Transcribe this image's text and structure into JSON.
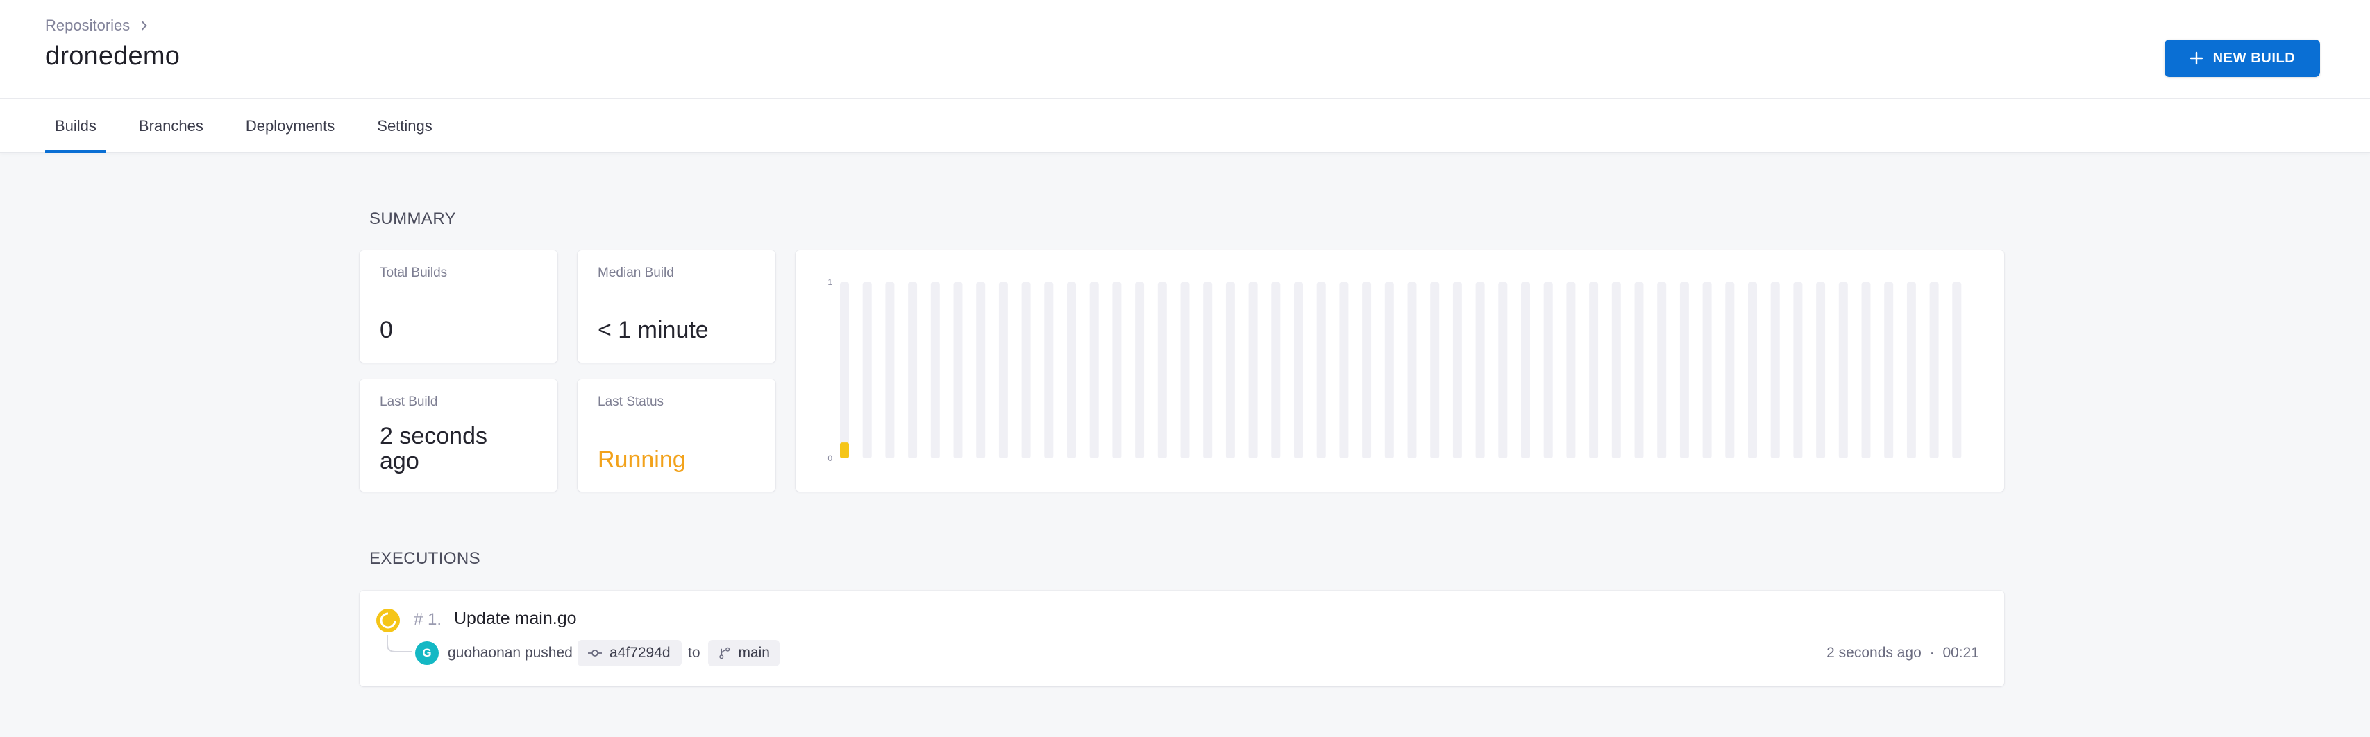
{
  "header": {
    "breadcrumb": "Repositories",
    "title": "dronedemo",
    "new_build_label": "NEW BUILD",
    "accent": "#0a6fd4"
  },
  "tabs": [
    {
      "label": "Builds",
      "active": true
    },
    {
      "label": "Branches",
      "active": false
    },
    {
      "label": "Deployments",
      "active": false
    },
    {
      "label": "Settings",
      "active": false
    }
  ],
  "summary": {
    "title": "SUMMARY",
    "total_builds": {
      "label": "Total Builds",
      "value": "0"
    },
    "median_build": {
      "label": "Median Build",
      "value": "< 1 minute"
    },
    "last_build": {
      "label": "Last Build",
      "value": "2 seconds ago"
    },
    "last_status": {
      "label": "Last Status",
      "value": "Running",
      "color": "#f2a21b"
    }
  },
  "chart_data": {
    "type": "bar",
    "ylim": [
      0,
      1
    ],
    "y_ticks": [
      "1",
      "0"
    ],
    "bar_count": 50,
    "values": [
      0.09,
      0,
      0,
      0,
      0,
      0,
      0,
      0,
      0,
      0,
      0,
      0,
      0,
      0,
      0,
      0,
      0,
      0,
      0,
      0,
      0,
      0,
      0,
      0,
      0,
      0,
      0,
      0,
      0,
      0,
      0,
      0,
      0,
      0,
      0,
      0,
      0,
      0,
      0,
      0,
      0,
      0,
      0,
      0,
      0,
      0,
      0,
      0,
      0,
      0
    ],
    "highlight_color": "#f5c518",
    "track_color": "#f0f0f5"
  },
  "executions": {
    "title": "EXECUTIONS",
    "items": [
      {
        "number": "# 1.",
        "title": "Update main.go",
        "author_initial": "G",
        "pushed_text": "guohaonan pushed",
        "commit": "a4f7294d",
        "to_text": "to",
        "branch": "main",
        "time": "2 seconds ago",
        "separator": "·",
        "duration": "00:21",
        "status_color": "#f5c518"
      }
    ]
  }
}
